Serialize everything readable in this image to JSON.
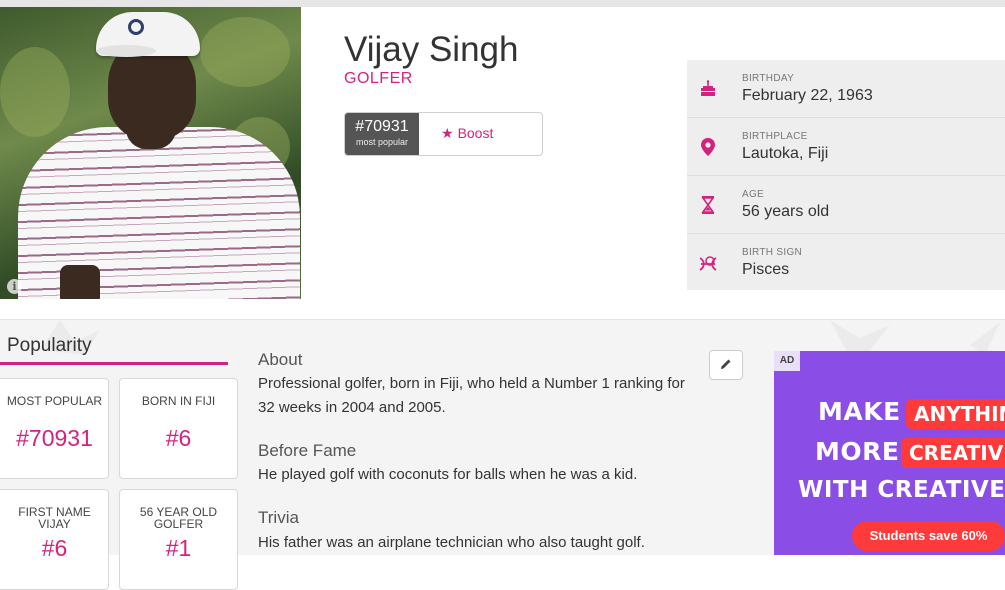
{
  "profile": {
    "name": "Vijay Singh",
    "profession": "GOLFER",
    "rank_number": "#70931",
    "rank_label": "most popular",
    "boost_label": "Boost"
  },
  "facts": [
    {
      "icon": "cake-icon",
      "label": "BIRTHDAY",
      "value": "February 22, 1963"
    },
    {
      "icon": "location-pin-icon",
      "label": "BIRTHPLACE",
      "value": "Lautoka, Fiji"
    },
    {
      "icon": "hourglass-icon",
      "label": "AGE",
      "value": "56 years old"
    },
    {
      "icon": "pisces-icon",
      "label": "BIRTH SIGN",
      "value": "Pisces"
    }
  ],
  "popularity": {
    "title": "Popularity",
    "stats": [
      {
        "label": "MOST POPULAR",
        "value": "#70931"
      },
      {
        "label": "BORN IN FIJI",
        "value": "#6"
      },
      {
        "label_line1": "FIRST NAME",
        "label_line2": "VIJAY",
        "value": "#6"
      },
      {
        "label_line1": "56 YEAR OLD",
        "label_line2": "GOLFER",
        "value": "#1"
      }
    ]
  },
  "about": {
    "sections": [
      {
        "heading": "About",
        "text": "Professional golfer, born in Fiji, who held a Number 1 ranking for 32 weeks in 2004 and 2005."
      },
      {
        "heading": "Before Fame",
        "text": "He played golf with coconuts for balls when he was a kid."
      },
      {
        "heading": "Trivia",
        "text": "His father was an airplane technician who also taught golf."
      }
    ]
  },
  "ad": {
    "tag": "AD",
    "line1_a": "MAKE",
    "line1_b": "ANYTHIN",
    "line2_a": "MORE",
    "line2_b": "CREATIV",
    "line3": "WITH CREATIVE CL",
    "cta": "Students save 60%"
  },
  "colors": {
    "accent": "#d4237f",
    "ad_background": "#8a4de6"
  }
}
